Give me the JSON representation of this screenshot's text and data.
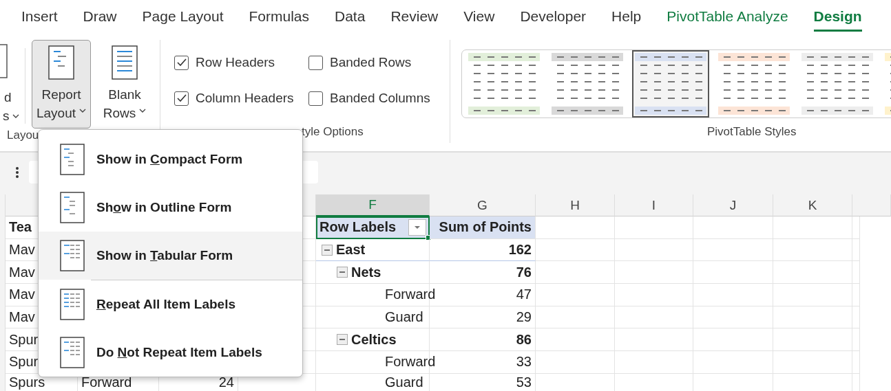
{
  "ribbon_tabs": [
    {
      "label": "Insert",
      "selected": false,
      "contextual": false
    },
    {
      "label": "Draw",
      "selected": false,
      "contextual": false
    },
    {
      "label": "Page Layout",
      "selected": false,
      "contextual": false
    },
    {
      "label": "Formulas",
      "selected": false,
      "contextual": false
    },
    {
      "label": "Data",
      "selected": false,
      "contextual": false
    },
    {
      "label": "Review",
      "selected": false,
      "contextual": false
    },
    {
      "label": "View",
      "selected": false,
      "contextual": false
    },
    {
      "label": "Developer",
      "selected": false,
      "contextual": false
    },
    {
      "label": "Help",
      "selected": false,
      "contextual": false
    },
    {
      "label": "PivotTable Analyze",
      "selected": false,
      "contextual": true
    },
    {
      "label": "Design",
      "selected": true,
      "contextual": true
    }
  ],
  "layout_group": {
    "label": "Layou",
    "cut_button": {
      "line_1": "d",
      "line_2": "s"
    },
    "buttons": [
      {
        "line_1": "Report",
        "line_2": "Layout",
        "pressed": true
      },
      {
        "line_1": "Blank",
        "line_2": "Rows",
        "pressed": false
      }
    ]
  },
  "style_options": {
    "label": "tyle Options",
    "checkboxes": [
      {
        "label": "Row Headers",
        "checked": true
      },
      {
        "label": "Banded Rows",
        "checked": false
      },
      {
        "label": "Column Headers",
        "checked": true
      },
      {
        "label": "Banded Columns",
        "checked": false
      }
    ]
  },
  "pivot_styles": {
    "label": "PivotTable Styles",
    "styles": [
      {
        "color": "#e2efda",
        "selected": false
      },
      {
        "color": "#d9d9d9",
        "selected": false
      },
      {
        "color": "#d9e1f2",
        "selected": true
      },
      {
        "color": "#fce4d6",
        "selected": false
      },
      {
        "color": "#ededed",
        "selected": false
      },
      {
        "color": "#fff2cc",
        "selected": false
      }
    ]
  },
  "column_headers": [
    {
      "label": "F",
      "selected": true
    },
    {
      "label": "G",
      "selected": false
    },
    {
      "label": "H",
      "selected": false
    },
    {
      "label": "I",
      "selected": false
    },
    {
      "label": "J",
      "selected": false
    },
    {
      "label": "K",
      "selected": false
    }
  ],
  "left_rows": [
    {
      "team": "Tea"
    },
    {
      "team": "Mav"
    },
    {
      "team": "Mav"
    },
    {
      "team": "Mav"
    },
    {
      "team": "Mav"
    },
    {
      "team": "Spur"
    },
    {
      "team": "Spur"
    },
    {
      "team": "Spurs",
      "column_2": "Forward",
      "column_3": "24"
    }
  ],
  "pivot": {
    "header": {
      "row_labels": "Row Labels",
      "values": "Sum of Points",
      "selected": true
    },
    "rows": [
      {
        "label": "East",
        "value": "162",
        "expanded": true,
        "children": [
          {
            "label": "Nets",
            "value": "76",
            "expanded": true,
            "children": [
              {
                "label": "Forward",
                "value": "47"
              },
              {
                "label": "Guard",
                "value": "29"
              }
            ]
          },
          {
            "label": "Celtics",
            "value": "86",
            "expanded": true,
            "children": [
              {
                "label": "Forward",
                "value": "33"
              },
              {
                "label": "Guard",
                "value": "53"
              }
            ]
          }
        ]
      }
    ]
  },
  "menu": {
    "items": [
      {
        "before": "Show in ",
        "key": "C",
        "after": "ompact Form",
        "highlighted": false
      },
      {
        "before": "Sh",
        "key": "o",
        "after": "w in Outline Form",
        "highlighted": false
      },
      {
        "before": "Show in ",
        "key": "T",
        "after": "abular Form",
        "highlighted": true
      },
      {
        "key": "R",
        "after": "epeat All Item Labels",
        "highlighted": false
      },
      {
        "before": "Do ",
        "key": "N",
        "after": "ot Repeat Item Labels",
        "highlighted": false
      }
    ]
  }
}
